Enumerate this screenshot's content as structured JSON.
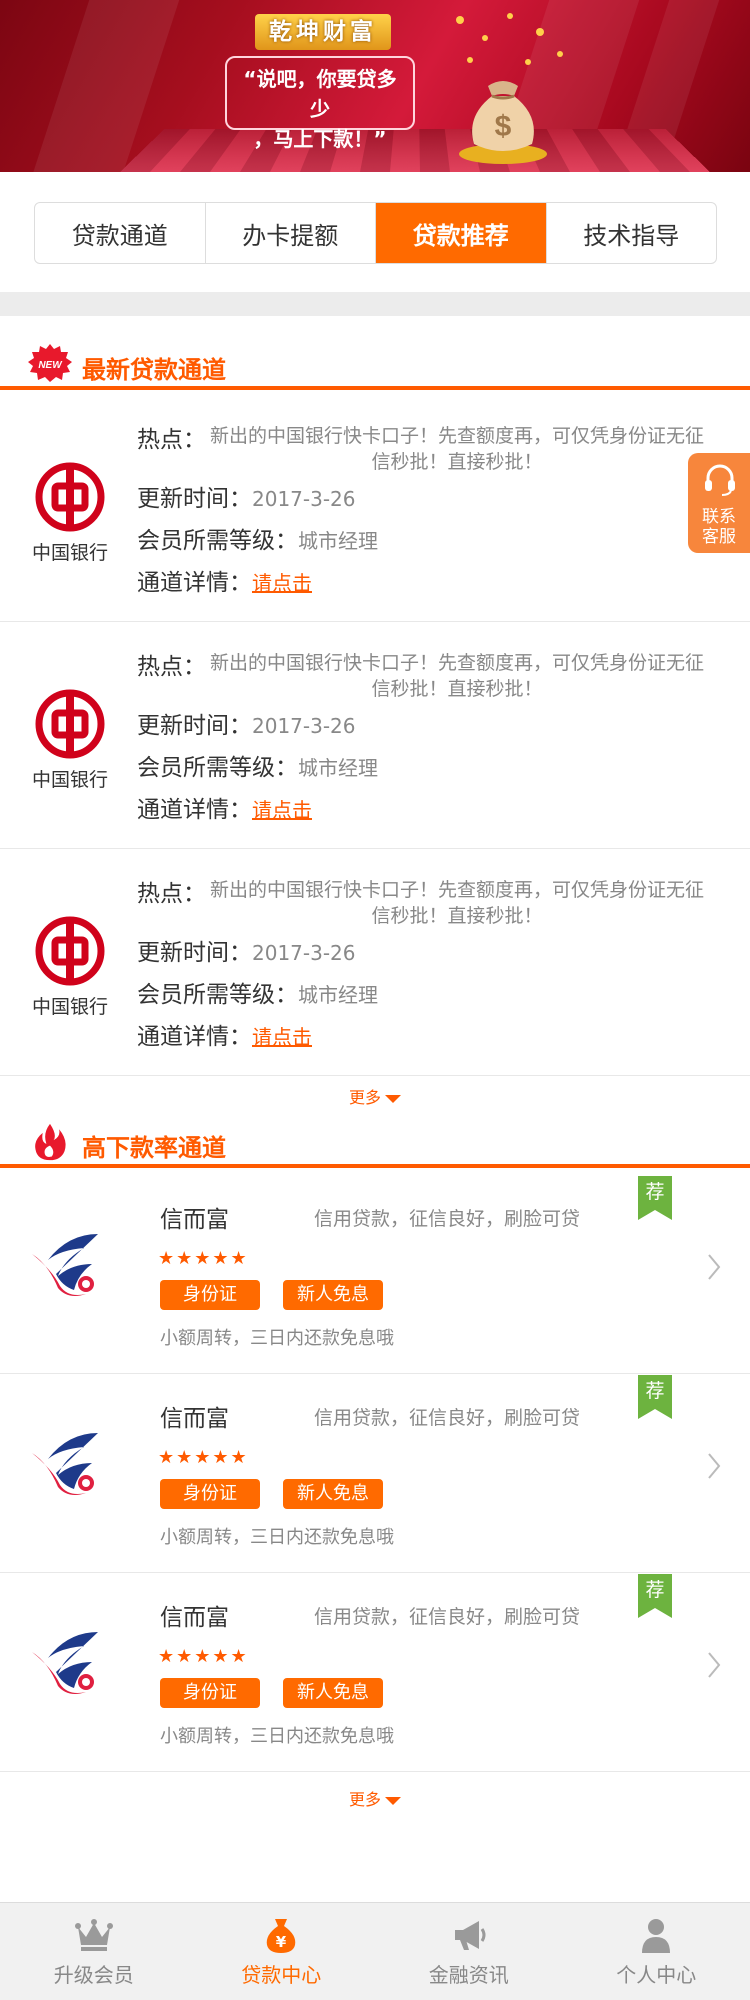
{
  "banner": {
    "brand": "乾坤财富",
    "slogan_line1": "“说吧，你要贷多少",
    "slogan_line2": "，马上下款！”"
  },
  "tabs": [
    {
      "label": "贷款通道",
      "active": false
    },
    {
      "label": "办卡提额",
      "active": false
    },
    {
      "label": "贷款推荐",
      "active": true
    },
    {
      "label": "技术指导",
      "active": false
    }
  ],
  "section1": {
    "title": "最新贷款通道",
    "badge": "NEW",
    "items": [
      {
        "bank_name": "中国银行",
        "hot_label": "热点：",
        "hot_text": "新出的中国银行快卡口子！先查额度再，可仅凭身份证无征信秒批！直接秒批！",
        "update_label": "更新时间：",
        "update_value": "2017-3-26",
        "level_label": "会员所需等级：",
        "level_value": "城市经理",
        "detail_label": "通道详情：",
        "detail_link": "请点击"
      },
      {
        "bank_name": "中国银行",
        "hot_label": "热点：",
        "hot_text": "新出的中国银行快卡口子！先查额度再，可仅凭身份证无征信秒批！直接秒批！",
        "update_label": "更新时间：",
        "update_value": "2017-3-26",
        "level_label": "会员所需等级：",
        "level_value": "城市经理",
        "detail_label": "通道详情：",
        "detail_link": "请点击"
      },
      {
        "bank_name": "中国银行",
        "hot_label": "热点：",
        "hot_text": "新出的中国银行快卡口子！先查额度再，可仅凭身份证无征信秒批！直接秒批！",
        "update_label": "更新时间：",
        "update_value": "2017-3-26",
        "level_label": "会员所需等级：",
        "level_value": "城市经理",
        "detail_label": "通道详情：",
        "detail_link": "请点击"
      }
    ],
    "more": "更多"
  },
  "float_service": {
    "label_line1": "联系",
    "label_line2": "客服"
  },
  "section2": {
    "title": "高下款率通道",
    "items": [
      {
        "name": "信而富",
        "desc": "信用贷款，征信良好，刷脸可贷",
        "stars": "★★★★★",
        "tag1": "身份证",
        "tag2": "新人免息",
        "note": "小额周转，三日内还款免息哦",
        "badge": "荐"
      },
      {
        "name": "信而富",
        "desc": "信用贷款，征信良好，刷脸可贷",
        "stars": "★★★★★",
        "tag1": "身份证",
        "tag2": "新人免息",
        "note": "小额周转，三日内还款免息哦",
        "badge": "荐"
      },
      {
        "name": "信而富",
        "desc": "信用贷款，征信良好，刷脸可贷",
        "stars": "★★★★★",
        "tag1": "身份证",
        "tag2": "新人免息",
        "note": "小额周转，三日内还款免息哦",
        "badge": "荐"
      }
    ],
    "more": "更多"
  },
  "bottom_nav": [
    {
      "label": "升级会员",
      "icon": "crown-icon",
      "active": false
    },
    {
      "label": "贷款中心",
      "icon": "money-bag-icon",
      "active": true
    },
    {
      "label": "金融资讯",
      "icon": "megaphone-icon",
      "active": false
    },
    {
      "label": "个人中心",
      "icon": "user-icon",
      "active": false
    }
  ],
  "colors": {
    "accent": "#ff6a00",
    "bank_red": "#d0021b",
    "banner_red": "#b5102a"
  }
}
